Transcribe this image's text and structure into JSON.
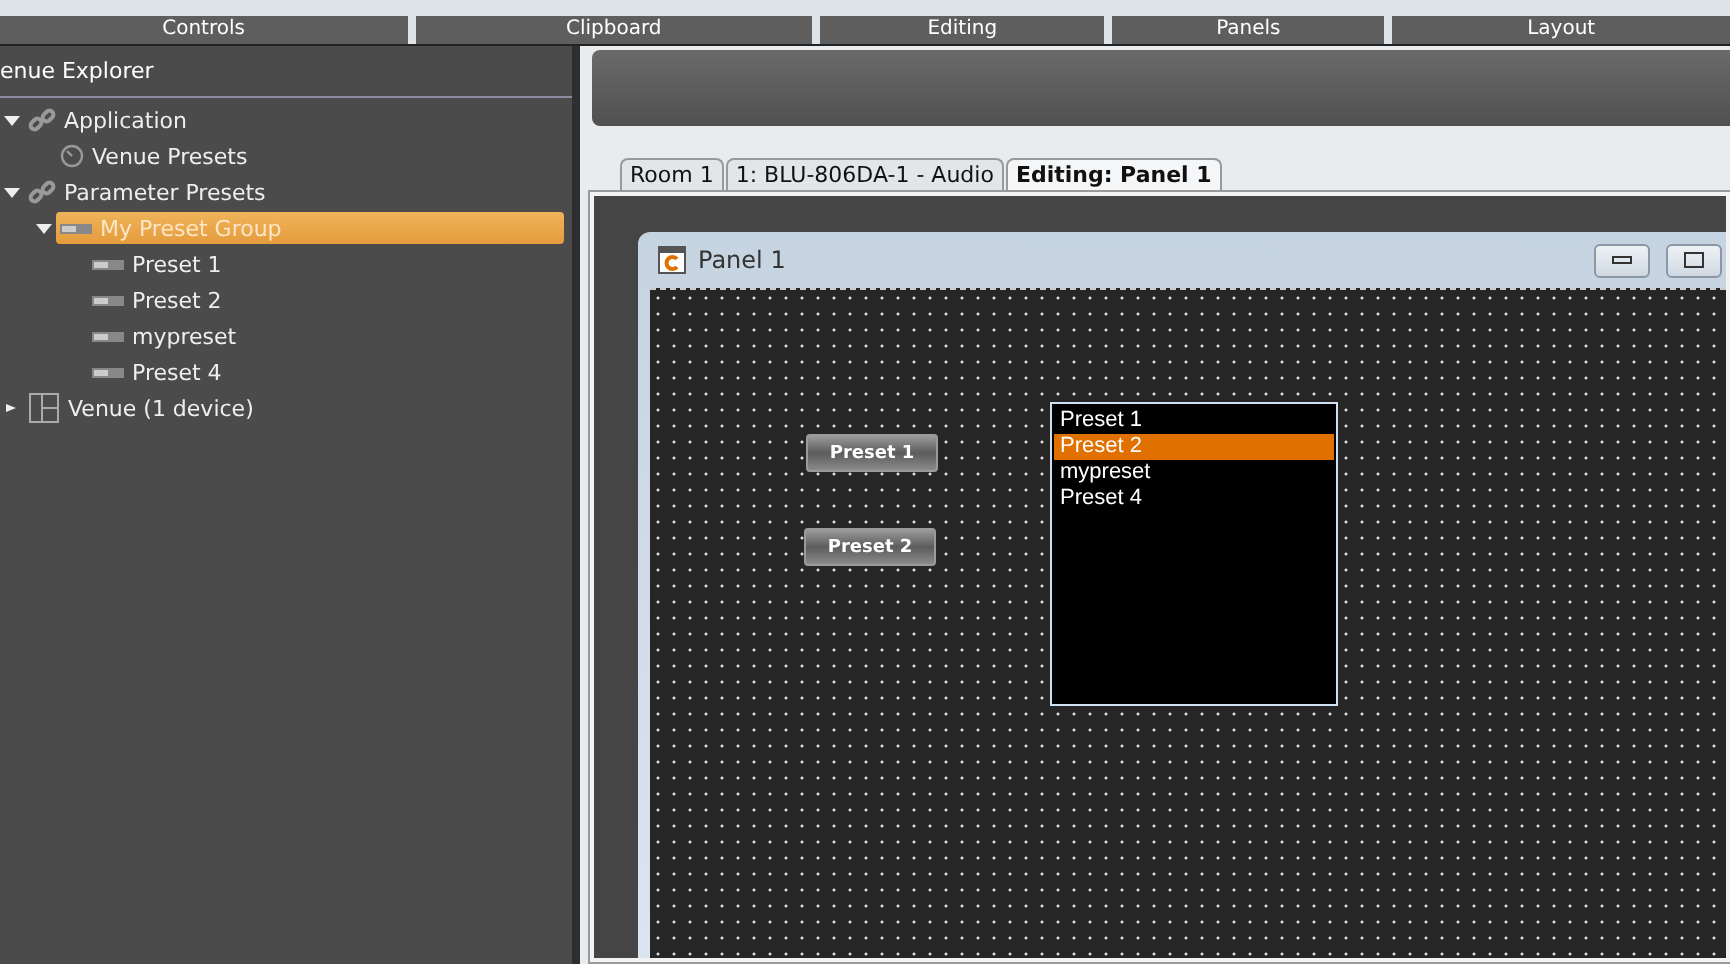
{
  "ribbon": {
    "groups": [
      "Controls",
      "Clipboard",
      "Editing",
      "Panels",
      "Layout"
    ]
  },
  "explorer": {
    "title": "enue Explorer",
    "tree": [
      {
        "label": "Application",
        "kind": "link",
        "expanded": true,
        "selected": false,
        "children": [
          {
            "label": "Venue Presets",
            "kind": "clock",
            "selected": false
          }
        ]
      },
      {
        "label": "Parameter Presets",
        "kind": "link",
        "expanded": true,
        "selected": false,
        "children": [
          {
            "label": "My Preset Group",
            "kind": "preset",
            "expanded": true,
            "selected": true,
            "children": [
              {
                "label": "Preset 1",
                "kind": "preset",
                "selected": false
              },
              {
                "label": "Preset 2",
                "kind": "preset",
                "selected": false
              },
              {
                "label": "mypreset",
                "kind": "preset",
                "selected": false
              },
              {
                "label": "Preset 4",
                "kind": "preset",
                "selected": false
              }
            ]
          }
        ]
      },
      {
        "label": "Venue (1 device)",
        "kind": "layout",
        "expanded": false,
        "selected": false
      }
    ]
  },
  "tabs": [
    {
      "label": "Room 1",
      "selected": false
    },
    {
      "label": "1: BLU-806DA-1 - Audio",
      "selected": false
    },
    {
      "label": "Editing: Panel 1",
      "selected": true
    }
  ],
  "panel": {
    "title": "Panel 1",
    "buttons": [
      "Preset 1",
      "Preset 2"
    ],
    "list": [
      {
        "label": "Preset 1",
        "selected": false
      },
      {
        "label": "Preset 2",
        "selected": true
      },
      {
        "label": "mypreset",
        "selected": false
      },
      {
        "label": "Preset 4",
        "selected": false
      }
    ]
  }
}
